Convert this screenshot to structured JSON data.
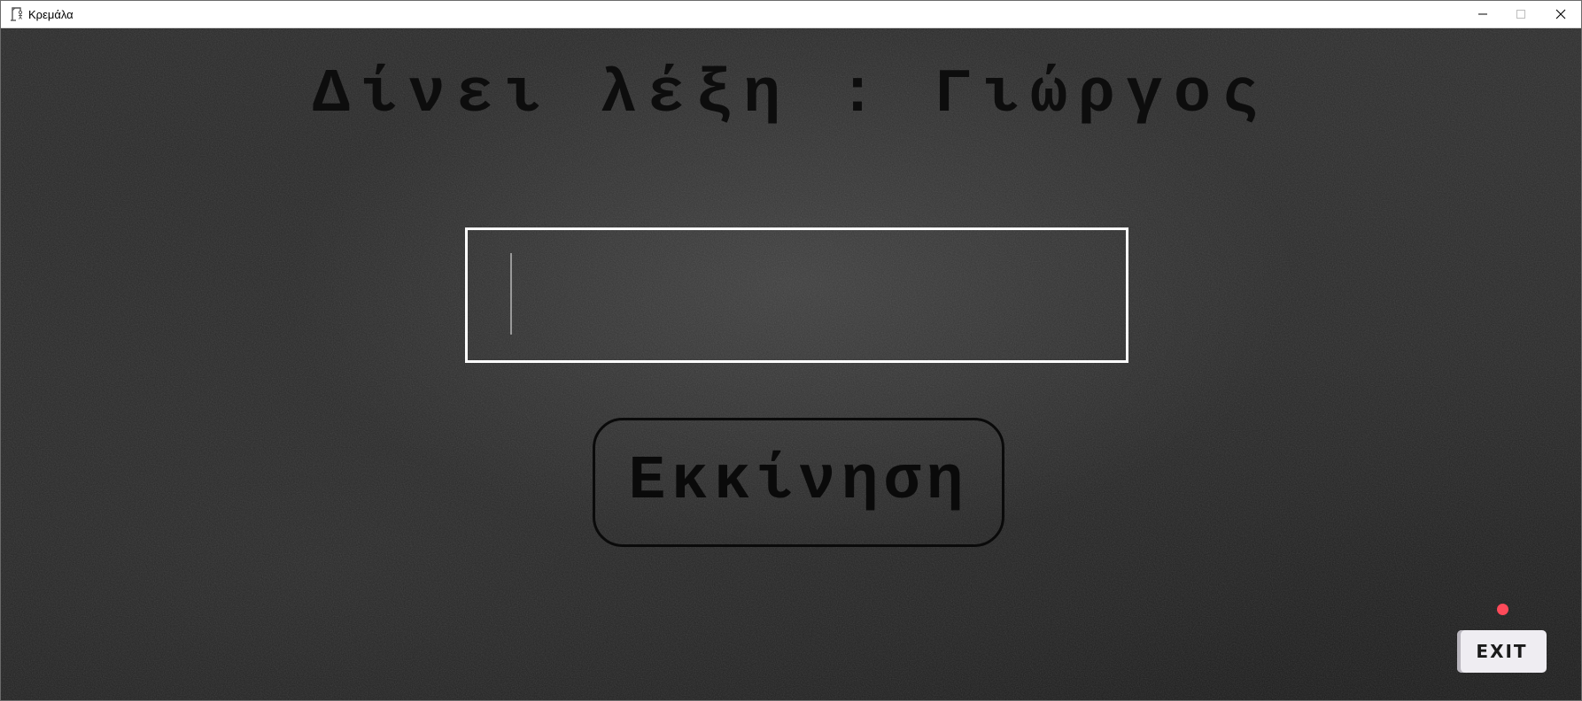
{
  "window": {
    "title": "Κρεμάλα",
    "controls": {
      "minimize_icon": "minimize-icon",
      "maximize_icon": "maximize-icon",
      "close_icon": "close-icon"
    }
  },
  "main": {
    "heading": "Δίνει λέξη : Γιώργος",
    "word_input": {
      "value": "",
      "placeholder": ""
    },
    "start_button": "Εκκίνηση",
    "exit_button": "EXIT"
  },
  "colors": {
    "background": "#262626",
    "heading_text": "#0d0d0d",
    "input_border": "#ffffff",
    "exit_button_bg": "#efedf2",
    "exit_indicator": "#ff4a5a"
  }
}
